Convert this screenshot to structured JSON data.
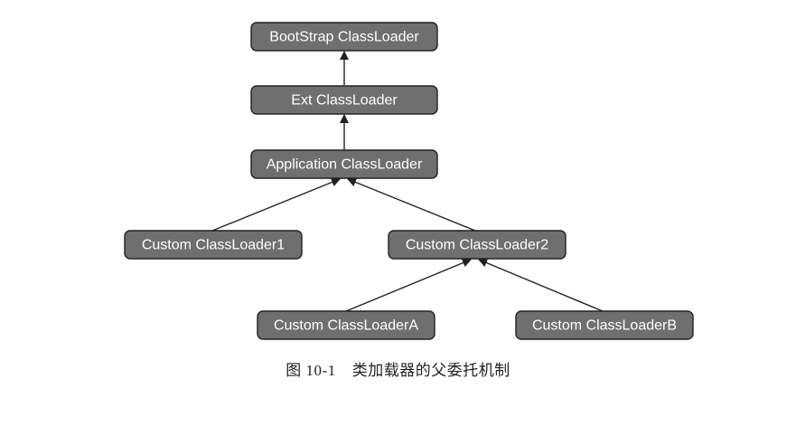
{
  "nodes": {
    "bootstrap": "BootStrap ClassLoader",
    "ext": "Ext ClassLoader",
    "application": "Application ClassLoader",
    "custom1": "Custom ClassLoader1",
    "custom2": "Custom ClassLoader2",
    "customA": "Custom ClassLoaderA",
    "customB": "Custom ClassLoaderB"
  },
  "caption": {
    "number": "图 10-1",
    "title": "类加载器的父委托机制"
  },
  "colors": {
    "node_fill": "#6f6f6f",
    "node_border": "#222222",
    "node_text": "#ffffff",
    "edge": "#222222"
  }
}
